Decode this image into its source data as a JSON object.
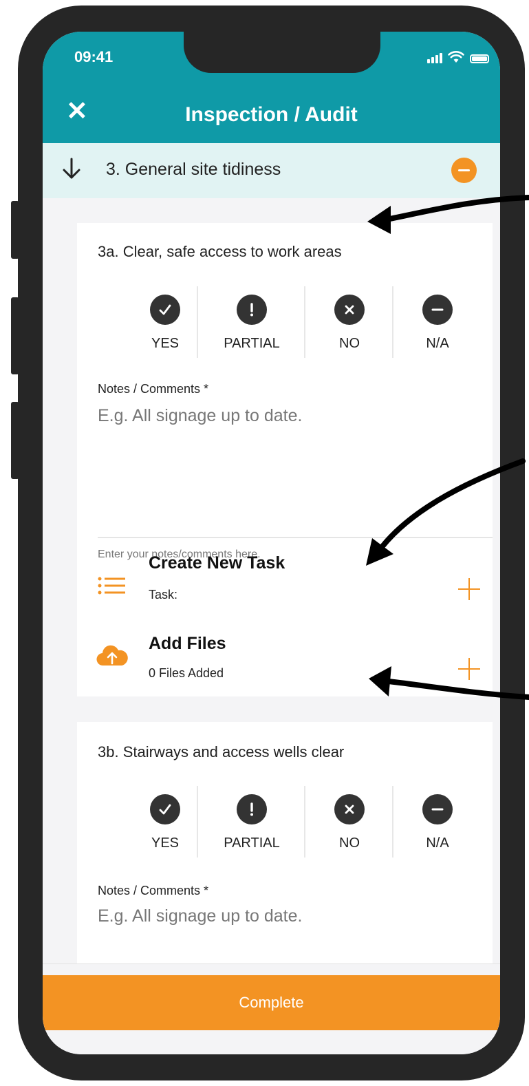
{
  "status_bar": {
    "time": "09:41"
  },
  "header": {
    "close_label": "✕",
    "title": "Inspection / Audit"
  },
  "section": {
    "title": "3. General site tidiness"
  },
  "questions": [
    {
      "title": "3a. Clear, safe access to work areas",
      "options": [
        "YES",
        "PARTIAL",
        "NO",
        "N/A"
      ],
      "notes_label": "Notes / Comments *",
      "notes_placeholder": "E.g. All signage up to date.",
      "notes_hint": "Enter your notes/comments here."
    },
    {
      "title": "3b. Stairways and access wells clear",
      "options": [
        "YES",
        "PARTIAL",
        "NO",
        "N/A"
      ],
      "notes_label": "Notes / Comments *",
      "notes_placeholder": "E.g. All signage up to date."
    }
  ],
  "actions": {
    "task": {
      "title": "Create New Task",
      "subtitle": "Task:"
    },
    "files": {
      "title": "Add Files",
      "subtitle": "0 Files Added"
    }
  },
  "footer": {
    "complete_label": "Complete"
  },
  "colors": {
    "teal": "#0f9aa7",
    "orange": "#f39323",
    "frame": "#262626"
  },
  "icons": [
    "check-icon",
    "exclamation-icon",
    "x-icon",
    "minus-icon",
    "list-icon",
    "cloud-upload-icon",
    "plus-icon",
    "arrow-down-icon",
    "close-icon",
    "signal-icon",
    "wifi-icon",
    "battery-icon"
  ]
}
